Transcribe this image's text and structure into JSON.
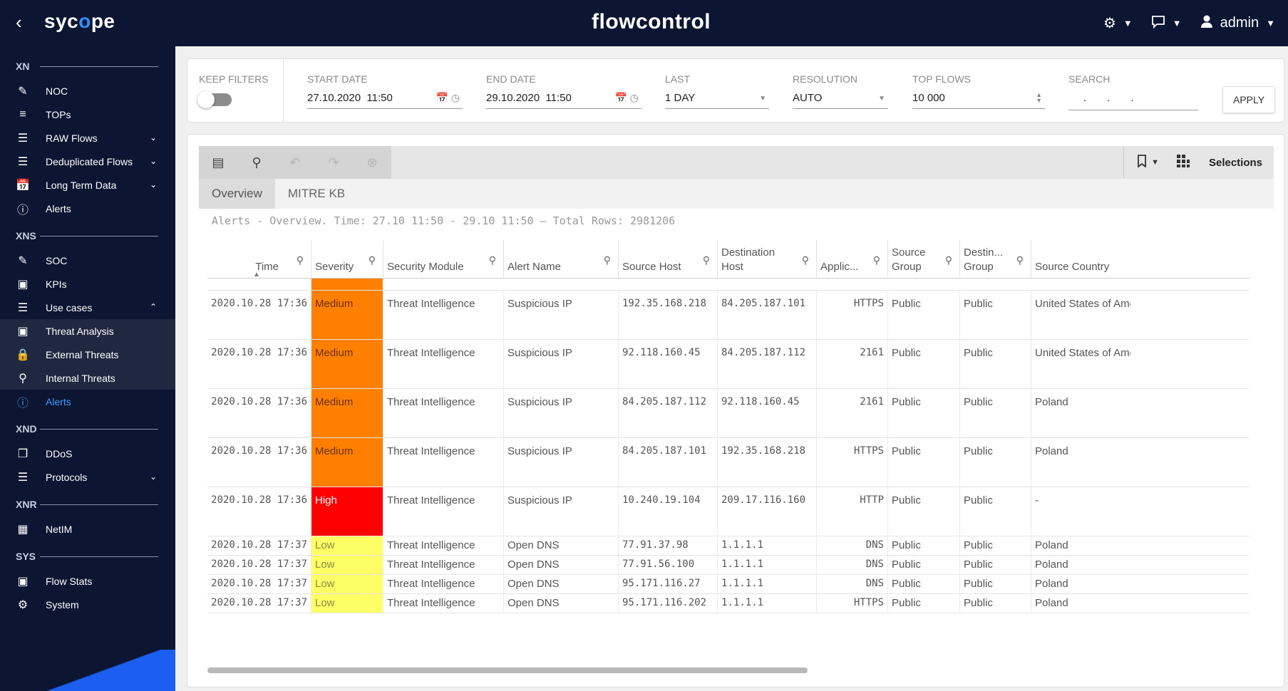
{
  "brand": {
    "prefix": "syc",
    "o": "o",
    "suffix": "pe"
  },
  "app_title": "flowcontrol",
  "user": {
    "name": "admin"
  },
  "sidebar": {
    "sections": [
      {
        "title": "XN",
        "items": [
          {
            "label": "NOC",
            "icon": "speedometer-icon"
          },
          {
            "label": "TOPs",
            "icon": "bars-icon"
          },
          {
            "label": "RAW Flows",
            "icon": "flows-icon",
            "chevron": "down"
          },
          {
            "label": "Deduplicated Flows",
            "icon": "flows-icon",
            "chevron": "down"
          },
          {
            "label": "Long Term Data",
            "icon": "calendar-icon",
            "chevron": "down"
          },
          {
            "label": "Alerts",
            "icon": "alert-circle-icon"
          }
        ]
      },
      {
        "title": "XNS",
        "items": [
          {
            "label": "SOC",
            "icon": "speedometer-icon"
          },
          {
            "label": "KPIs",
            "icon": "monitor-icon"
          },
          {
            "label": "Use cases",
            "icon": "list-icon",
            "chevron": "up"
          },
          {
            "label": "Threat Analysis",
            "icon": "monitor-icon",
            "sub": true
          },
          {
            "label": "External Threats",
            "icon": "lock-icon",
            "sub": true
          },
          {
            "label": "Internal Threats",
            "icon": "search-icon",
            "sub": true
          },
          {
            "label": "Alerts",
            "icon": "alert-circle-icon",
            "active": true
          }
        ]
      },
      {
        "title": "XND",
        "items": [
          {
            "label": "DDoS",
            "icon": "layers-icon"
          },
          {
            "label": "Protocols",
            "icon": "list-icon",
            "chevron": "down"
          }
        ]
      },
      {
        "title": "XNR",
        "items": [
          {
            "label": "NetIM",
            "icon": "grid-icon"
          }
        ]
      },
      {
        "title": "SYS",
        "items": [
          {
            "label": "Flow Stats",
            "icon": "monitor-icon"
          },
          {
            "label": "System",
            "icon": "gear-icon"
          }
        ]
      }
    ]
  },
  "filters": {
    "keep_filters": {
      "label": "KEEP FILTERS",
      "on": false
    },
    "start_date": {
      "label": "START DATE",
      "value": "27.10.2020  11:50"
    },
    "end_date": {
      "label": "END DATE",
      "value": "29.10.2020  11:50"
    },
    "last": {
      "label": "LAST",
      "value": "1 DAY"
    },
    "resolution": {
      "label": "RESOLUTION",
      "value": "AUTO"
    },
    "top_flows": {
      "label": "TOP FLOWS",
      "value": "10 000"
    },
    "search": {
      "label": "SEARCH",
      "value": "     .       .       ."
    },
    "apply": "APPLY"
  },
  "toolbar": {
    "selections": "Selections"
  },
  "tabs": [
    {
      "label": "Overview",
      "active": true
    },
    {
      "label": "MITRE KB",
      "active": false
    }
  ],
  "table": {
    "caption": "Alerts - Overview. Time: 27.10 11:50 - 29.10 11:50 — Total Rows: 2981206",
    "columns": [
      {
        "label": "Time"
      },
      {
        "label": "Severity"
      },
      {
        "label": "Security Module"
      },
      {
        "label": "Alert Name"
      },
      {
        "label": "Source Host"
      },
      {
        "label": "Destination Host"
      },
      {
        "label": "Applic..."
      },
      {
        "label": "Source Group"
      },
      {
        "label": "Destin... Group"
      },
      {
        "label": "Source Country"
      }
    ],
    "rows": [
      {
        "time": "2020.10.28 17:36",
        "severity": "Medium",
        "module": "Threat Intelligence",
        "alert": "Suspicious IP",
        "src": "192.35.168.218",
        "dst": "84.205.187.101",
        "app": "HTTPS",
        "src_group": "Public",
        "dst_group": "Public",
        "country": "United States of America"
      },
      {
        "time": "2020.10.28 17:36",
        "severity": "Medium",
        "module": "Threat Intelligence",
        "alert": "Suspicious IP",
        "src": "92.118.160.45",
        "dst": "84.205.187.112",
        "app": "2161",
        "src_group": "Public",
        "dst_group": "Public",
        "country": "United States of America"
      },
      {
        "time": "2020.10.28 17:36",
        "severity": "Medium",
        "module": "Threat Intelligence",
        "alert": "Suspicious IP",
        "src": "84.205.187.112",
        "dst": "92.118.160.45",
        "app": "2161",
        "src_group": "Public",
        "dst_group": "Public",
        "country": "Poland"
      },
      {
        "time": "2020.10.28 17:36",
        "severity": "Medium",
        "module": "Threat Intelligence",
        "alert": "Suspicious IP",
        "src": "84.205.187.101",
        "dst": "192.35.168.218",
        "app": "HTTPS",
        "src_group": "Public",
        "dst_group": "Public",
        "country": "Poland"
      },
      {
        "time": "2020.10.28 17:36",
        "severity": "High",
        "module": "Threat Intelligence",
        "alert": "Suspicious IP",
        "src": "10.240.19.104",
        "dst": "209.17.116.160",
        "app": "HTTP",
        "src_group": "Public",
        "dst_group": "Public",
        "country": "-"
      },
      {
        "time": "2020.10.28 17:37",
        "severity": "Low",
        "module": "Threat Intelligence",
        "alert": "Open DNS",
        "src": "77.91.37.98",
        "dst": "1.1.1.1",
        "app": "DNS",
        "src_group": "Public",
        "dst_group": "Public",
        "country": "Poland"
      },
      {
        "time": "2020.10.28 17:37",
        "severity": "Low",
        "module": "Threat Intelligence",
        "alert": "Open DNS",
        "src": "77.91.56.100",
        "dst": "1.1.1.1",
        "app": "DNS",
        "src_group": "Public",
        "dst_group": "Public",
        "country": "Poland"
      },
      {
        "time": "2020.10.28 17:37",
        "severity": "Low",
        "module": "Threat Intelligence",
        "alert": "Open DNS",
        "src": "95.171.116.27",
        "dst": "1.1.1.1",
        "app": "DNS",
        "src_group": "Public",
        "dst_group": "Public",
        "country": "Poland"
      },
      {
        "time": "2020.10.28 17:37",
        "severity": "Low",
        "module": "Threat Intelligence",
        "alert": "Open DNS",
        "src": "95.171.116.202",
        "dst": "1.1.1.1",
        "app": "HTTPS",
        "src_group": "Public",
        "dst_group": "Public",
        "country": "Poland"
      }
    ]
  },
  "colors": {
    "navy": "#0c1531",
    "accent": "#3a9cff",
    "severity_medium": "#ff8000",
    "severity_high": "#ff0000",
    "severity_low": "#ffff66"
  }
}
